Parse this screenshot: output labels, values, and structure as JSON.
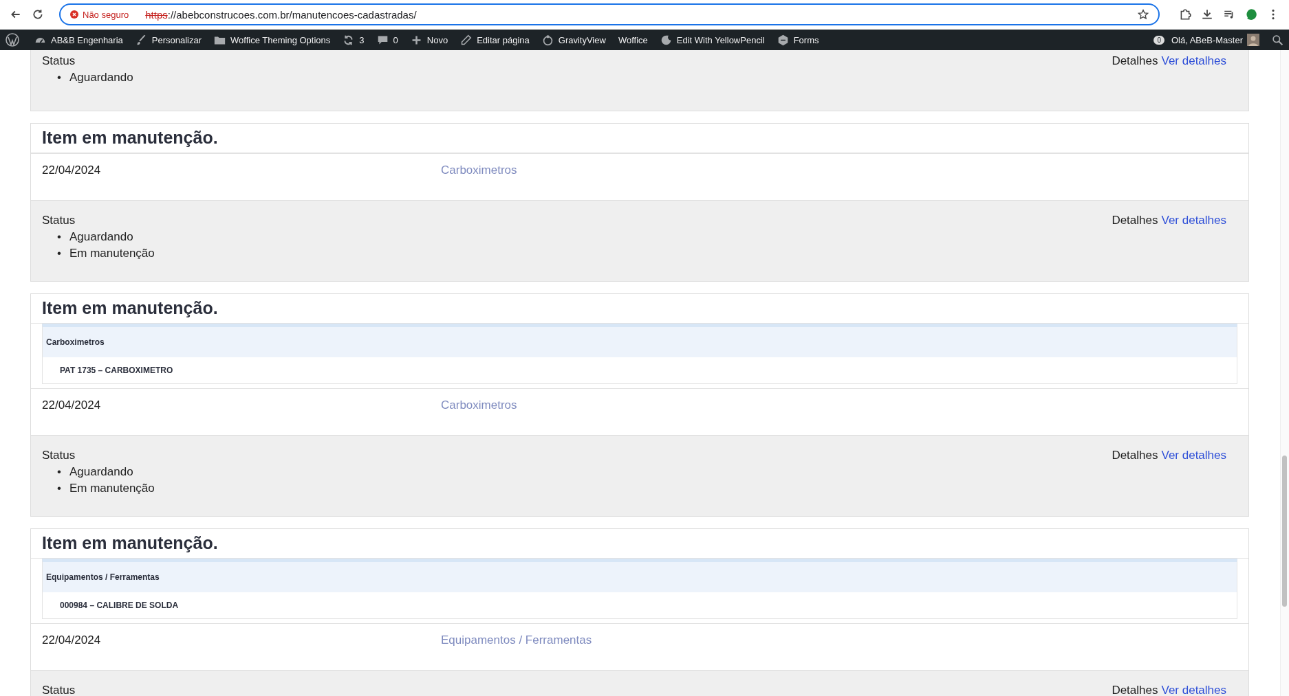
{
  "browser": {
    "security": "Não seguro",
    "url_scheme": "https",
    "url_rest": "://abebconstrucoes.com.br/manutencoes-cadastradas/"
  },
  "admin_bar": {
    "items": [
      {
        "kind": "logo"
      },
      {
        "kind": "link",
        "label": "AB&B Engenharia"
      },
      {
        "kind": "link",
        "label": "Personalizar"
      },
      {
        "kind": "link",
        "label": "Woffice Theming Options"
      },
      {
        "kind": "link",
        "label": "3"
      },
      {
        "kind": "link",
        "label": "0"
      },
      {
        "kind": "link",
        "label": "Novo"
      },
      {
        "kind": "link",
        "label": "Editar página"
      },
      {
        "kind": "link",
        "label": "GravityView"
      },
      {
        "kind": "link",
        "label": "Woffice"
      },
      {
        "kind": "link",
        "label": "Edit With YellowPencil"
      },
      {
        "kind": "link",
        "label": "Forms"
      }
    ],
    "notifications": "0",
    "greeting": "Olá, ABeB-Master"
  },
  "cards": [
    {
      "status_label": "Status",
      "statuses": [
        {
          "marker": "•",
          "text": "Aguardando"
        }
      ],
      "details_label": "Detalhes",
      "details_link": "Ver detalhes"
    },
    {
      "title": "Item em manutenção.",
      "date": "22/04/2024",
      "category": "Carboximetros",
      "status_label": "Status",
      "statuses": [
        {
          "marker": "•",
          "text": "Aguardando"
        },
        {
          "marker": "•",
          "text": "Em manutenção"
        }
      ],
      "details_label": "Detalhes",
      "details_link": "Ver detalhes"
    },
    {
      "title": "Item em manutenção.",
      "table": {
        "heading": "Carboximetros",
        "row": "PAT 1735 – CARBOXIMETRO"
      },
      "date": "22/04/2024",
      "category": "Carboximetros",
      "status_label": "Status",
      "statuses": [
        {
          "marker": "•",
          "text": "Aguardando"
        },
        {
          "marker": "•",
          "text": "Em manutenção"
        }
      ],
      "details_label": "Detalhes",
      "details_link": "Ver detalhes"
    },
    {
      "title": "Item em manutenção.",
      "table": {
        "heading": "Equipamentos / Ferramentas",
        "row": "000984 – CALIBRE DE SOLDA"
      },
      "date": "22/04/2024",
      "category": "Equipamentos / Ferramentas",
      "status_label": "Status",
      "details_label": "Detalhes",
      "details_link": "Ver detalhes"
    }
  ]
}
